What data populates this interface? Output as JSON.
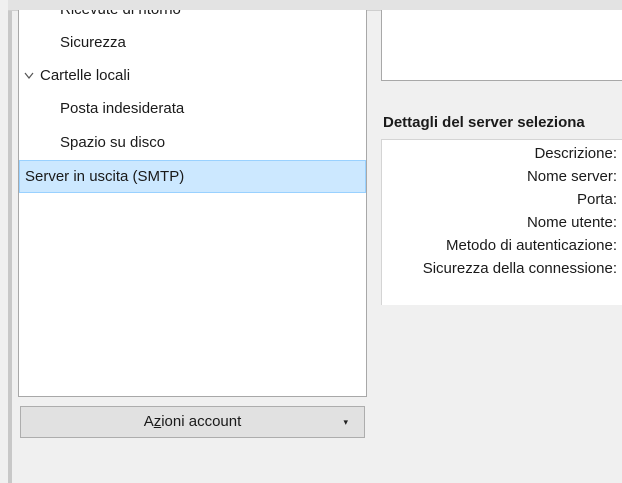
{
  "account_tree": {
    "items": [
      {
        "label": "Ricevute di ritorno"
      },
      {
        "label": "Sicurezza"
      },
      {
        "label": "Cartelle locali",
        "expanded": true
      },
      {
        "label": "Posta indesiderata"
      },
      {
        "label": "Spazio su disco"
      },
      {
        "label": "Server in uscita (SMTP)",
        "selected": true
      }
    ]
  },
  "actions_button": {
    "label_pre": "A",
    "label_accel": "z",
    "label_post": "ioni account",
    "dropdown_glyph": "▾"
  },
  "details": {
    "title": "Dettagli del server seleziona",
    "fields": [
      {
        "label": "Descrizione:"
      },
      {
        "label": "Nome server:"
      },
      {
        "label": "Porta:"
      },
      {
        "label": "Nome utente:"
      },
      {
        "label": "Metodo di autenticazione:"
      },
      {
        "label": "Sicurezza della connessione:"
      }
    ]
  },
  "colors": {
    "selection_bg": "#cce8ff",
    "selection_border": "#99d1ff",
    "window_bg": "#f0f0f0"
  }
}
